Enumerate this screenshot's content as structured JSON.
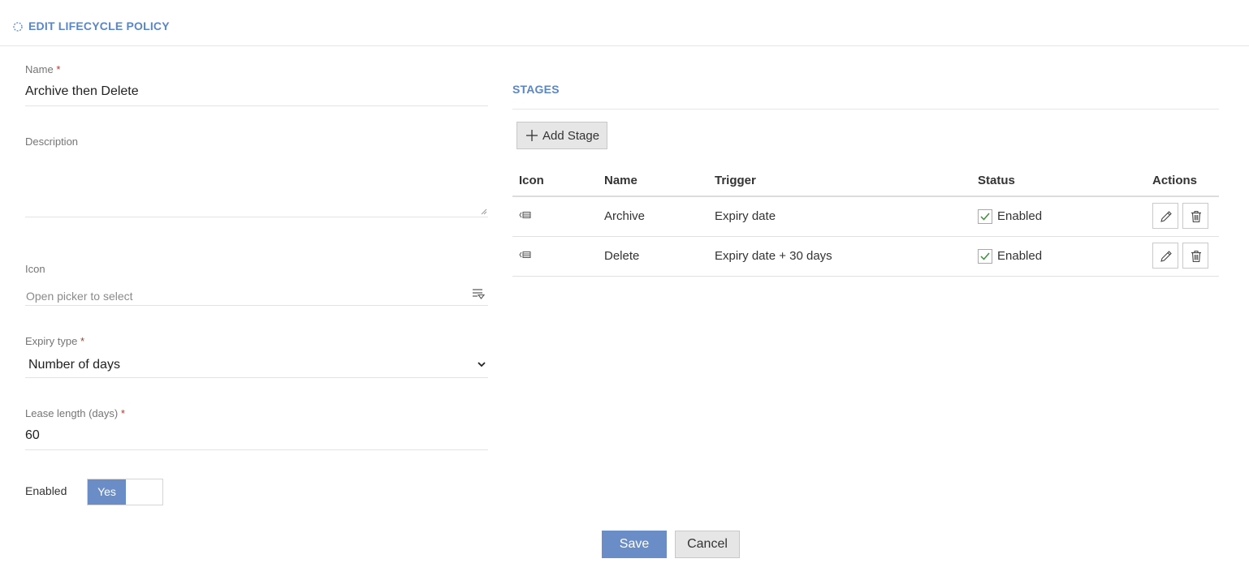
{
  "header": {
    "title": "EDIT LIFECYCLE POLICY",
    "loading_icon": "spinner-icon"
  },
  "form": {
    "name": {
      "label": "Name",
      "required_mark": "*",
      "value": "Archive then Delete"
    },
    "description": {
      "label": "Description",
      "value": ""
    },
    "icon": {
      "label": "Icon",
      "placeholder": "Open picker to select",
      "picker_icon": "filter-list-icon"
    },
    "expiry_type": {
      "label": "Expiry type",
      "required_mark": "*",
      "value": "Number of days"
    },
    "lease_length": {
      "label": "Lease length (days)",
      "required_mark": "*",
      "value": "60"
    },
    "enabled": {
      "label": "Enabled",
      "toggle_on_label": "Yes",
      "state": true
    }
  },
  "stages": {
    "title": "STAGES",
    "add_button_label": "Add Stage",
    "columns": [
      "Icon",
      "Name",
      "Trigger",
      "Status",
      "Actions"
    ],
    "rows": [
      {
        "icon": "archive-list-icon",
        "name": "Archive",
        "trigger": "Expiry date",
        "status": "Enabled",
        "checked": true
      },
      {
        "icon": "archive-list-icon",
        "name": "Delete",
        "trigger": "Expiry date + 30 days",
        "status": "Enabled",
        "checked": true
      }
    ]
  },
  "footer": {
    "save_label": "Save",
    "cancel_label": "Cancel"
  },
  "colors": {
    "accent": "#5b86c5",
    "primary_button": "#6b8dc7",
    "required": "#b03a2e",
    "check": "#3f8f3f"
  }
}
